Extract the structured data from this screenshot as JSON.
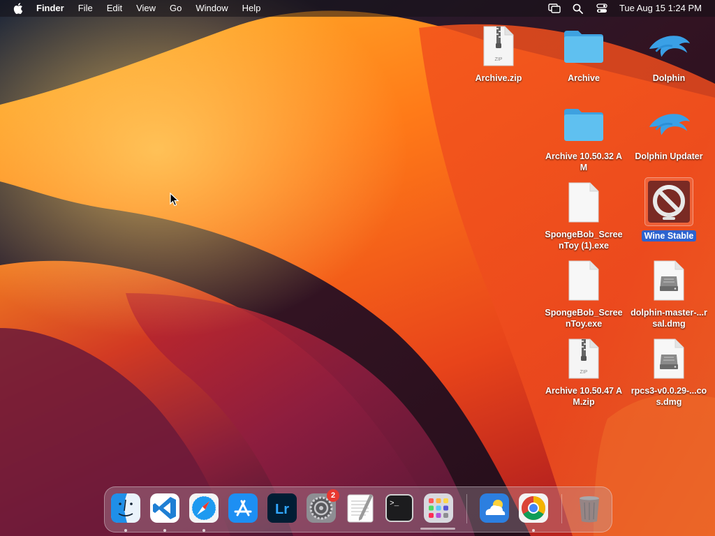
{
  "menubar": {
    "app_name": "Finder",
    "menus": [
      "File",
      "Edit",
      "View",
      "Go",
      "Window",
      "Help"
    ],
    "clock": "Tue Aug 15  1:24 PM"
  },
  "desktop": {
    "items": [
      {
        "label": "Archive.zip",
        "kind": "zip-icon"
      },
      {
        "label": "Archive",
        "kind": "folder-icon"
      },
      {
        "label": "Dolphin",
        "kind": "dolphin-icon"
      },
      {
        "label": "Archive 10.50.32 AM",
        "kind": "folder-icon"
      },
      {
        "label": "Dolphin Updater",
        "kind": "dolphin-icon"
      },
      {
        "label": "SpongeBob_ScreenToy (1).exe",
        "kind": "document-icon"
      },
      {
        "label": "Wine Stable",
        "kind": "wine-icon",
        "selected": true
      },
      {
        "label": "SpongeBob_ScreenToy.exe",
        "kind": "document-icon"
      },
      {
        "label": "dolphin-master-...rsal.dmg",
        "kind": "disk-image-icon"
      },
      {
        "label": "Archive 10.50.47 AM.zip",
        "kind": "zip-icon"
      },
      {
        "label": "rpcs3-v0.0.29-...cos.dmg",
        "kind": "disk-image-icon"
      }
    ]
  },
  "dock": {
    "settings_badge": "2",
    "terminal_prompt": ">_",
    "lightroom_text": "Lr",
    "zip_tag": "ZIP"
  },
  "colors": {
    "folder": "#4fb3ea",
    "selection": "#2d63cf",
    "badge": "#e8372f"
  }
}
